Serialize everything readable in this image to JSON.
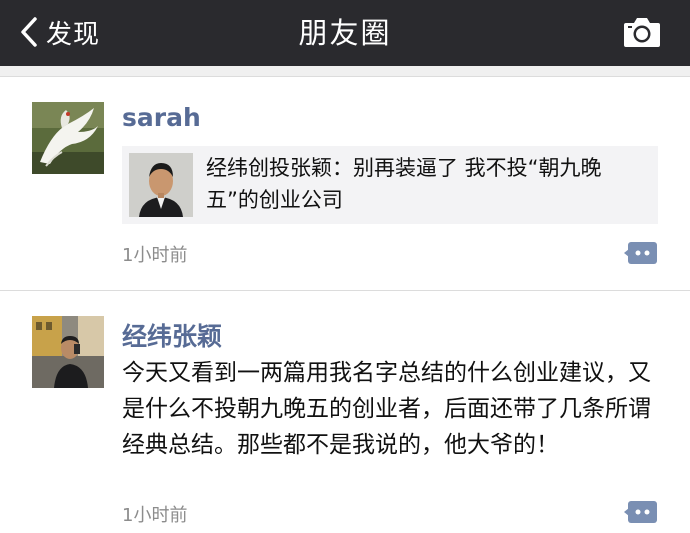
{
  "navbar": {
    "back_label": "发现",
    "title": "朋友圈"
  },
  "posts": [
    {
      "username": "sarah",
      "link": {
        "title": "经纬创投张颖：别再装逼了 我不投“朝九晚五”的创业公司"
      },
      "time": "1小时前"
    },
    {
      "username": "经纬张颖",
      "text": "今天又看到一两篇用我名字总结的什么创业建议，又是什么不投朝九晚五的创业者，后面还带了几条所谓经典总结。那些都不是我说的，他大爷的！",
      "time": "1小时前"
    }
  ],
  "colors": {
    "navbar_bg": "#2a2a2e",
    "username": "#576b95",
    "link_card_bg": "#f3f3f5",
    "time": "#8c8c8c",
    "comment_icon": "#7a8fb3"
  },
  "icons": {
    "back": "chevron-left-icon",
    "camera": "camera-icon",
    "comment": "comment-icon"
  }
}
